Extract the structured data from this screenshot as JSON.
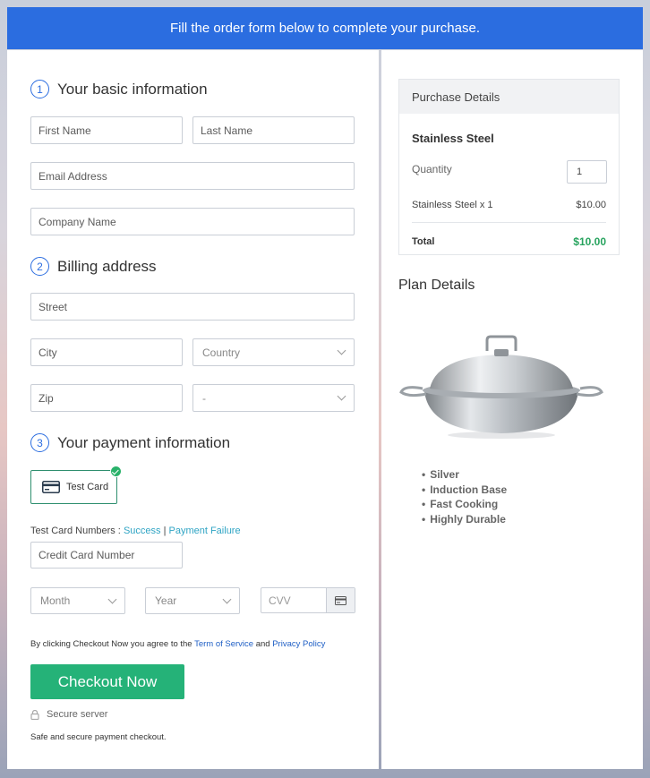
{
  "banner": {
    "text": "Fill the order form below to complete your purchase."
  },
  "basic_info": {
    "step": "1",
    "title": "Your basic information",
    "first_name_placeholder": "First Name",
    "last_name_placeholder": "Last Name",
    "email_placeholder": "Email Address",
    "company_placeholder": "Company Name"
  },
  "billing": {
    "step": "2",
    "title": "Billing address",
    "street_placeholder": "Street",
    "city_placeholder": "City",
    "country_selected": "Country",
    "zip_placeholder": "Zip",
    "state_selected": "-"
  },
  "payment": {
    "step": "3",
    "title": "Your payment information",
    "test_card_label": "Test Card",
    "test_numbers_prefix": "Test Card Numbers :",
    "success_link": "Success",
    "separator": "|",
    "failure_link": "Payment Failure",
    "card_number_placeholder": "Credit Card Number",
    "month_selected": "Month",
    "year_selected": "Year",
    "cvv_placeholder": "CVV"
  },
  "agreement": {
    "prefix": "By clicking Checkout Now you agree to the",
    "terms_link": "Term of Service",
    "and": "and",
    "privacy_link": "Privacy Policy"
  },
  "checkout_button": "Checkout Now",
  "secure_server": "Secure server",
  "secure_note": "Safe and secure payment checkout.",
  "purchase": {
    "header": "Purchase Details",
    "product_name": "Stainless Steel",
    "quantity_label": "Quantity",
    "quantity_value": "1",
    "line_item": "Stainless Steel x 1",
    "line_price": "$10.00",
    "total_label": "Total",
    "total_value": "$10.00"
  },
  "plan": {
    "title": "Plan Details",
    "features": [
      "Silver",
      "Induction Base",
      "Fast Cooking",
      "Highly Durable"
    ]
  },
  "colors": {
    "banner": "#2b6de0",
    "accent_blue": "#2b6de0",
    "checkout_green": "#25b278",
    "total_green": "#27a35e",
    "link": "#2fa4c4"
  },
  "icons": [
    "credit-card-icon",
    "check-badge-icon",
    "lock-icon",
    "chevron-down-icon",
    "cvv-card-icon"
  ]
}
